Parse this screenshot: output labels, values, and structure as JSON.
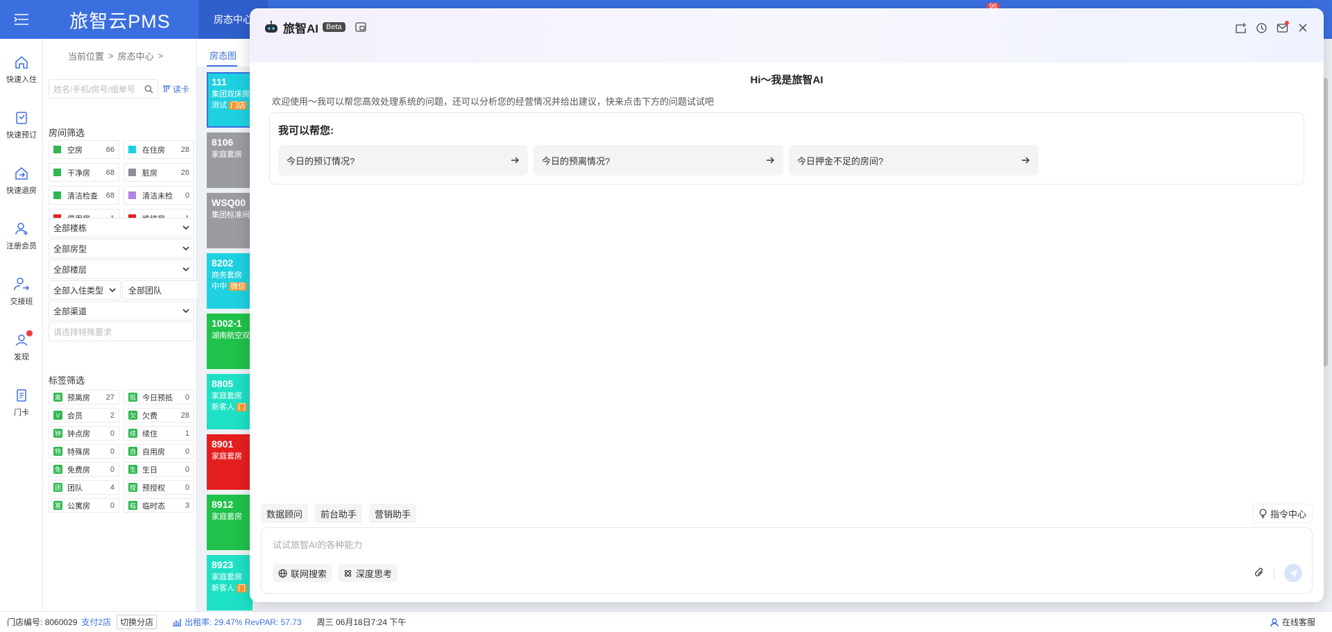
{
  "app": {
    "logo": "旅智云PMS",
    "top_tab": "房态中心",
    "top_badge": "96"
  },
  "rail": {
    "items": [
      {
        "label": "快速入住",
        "icon": "home-icon"
      },
      {
        "label": "快速预订",
        "icon": "booking-icon"
      },
      {
        "label": "快速退房",
        "icon": "checkout-icon"
      },
      {
        "label": "注册会员",
        "icon": "add-user-icon"
      },
      {
        "label": "交接班",
        "icon": "handover-icon"
      },
      {
        "label": "发现",
        "icon": "discover-icon"
      },
      {
        "label": "门卡",
        "icon": "card-icon"
      }
    ]
  },
  "filter": {
    "breadcrumb": [
      "当前位置",
      ">",
      "房态中心",
      ">"
    ],
    "search_placeholder": "姓名/手机/房号/组单号",
    "read_card": "读卡",
    "room_filter_title": "房间筛选",
    "room_status": [
      {
        "label": "空房",
        "count": "66",
        "color": "#2eb84f"
      },
      {
        "label": "在住房",
        "count": "28",
        "color": "#1ed1e0"
      },
      {
        "label": "干净房",
        "count": "68",
        "color": "#2eb84f"
      },
      {
        "label": "脏房",
        "count": "26",
        "color": "#8c8f96"
      },
      {
        "label": "清洁检查",
        "count": "68",
        "color": "#2eb84f"
      },
      {
        "label": "清洁未检",
        "count": "0",
        "color": "#b680e8"
      },
      {
        "label": "停用房",
        "count": "1",
        "color": "#e51f1f"
      },
      {
        "label": "维修房",
        "count": "1",
        "color": "#e51f1f"
      }
    ],
    "selects": {
      "building": "全部楼栋",
      "room_type": "全部房型",
      "floor": "全部楼层",
      "checkin_type": "全部入住类型",
      "team": "全部团队",
      "channel": "全部渠道"
    },
    "special_placeholder": "请选择特殊要求",
    "tag_filter_title": "标签筛选",
    "tags": [
      {
        "icon": "离",
        "label": "预离房",
        "count": "27"
      },
      {
        "icon": "抵",
        "label": "今日预抵",
        "count": "0"
      },
      {
        "icon": "V",
        "label": "会员",
        "count": "2"
      },
      {
        "icon": "欠",
        "label": "欠费",
        "count": "28"
      },
      {
        "icon": "钟",
        "label": "钟点房",
        "count": "0"
      },
      {
        "icon": "续",
        "label": "续住",
        "count": "1"
      },
      {
        "icon": "特",
        "label": "特殊房",
        "count": "0"
      },
      {
        "icon": "自",
        "label": "自用房",
        "count": "0"
      },
      {
        "icon": "免",
        "label": "免费房",
        "count": "0"
      },
      {
        "icon": "生",
        "label": "生日",
        "count": "0"
      },
      {
        "icon": "团",
        "label": "团队",
        "count": "4"
      },
      {
        "icon": "授",
        "label": "预授权",
        "count": "0"
      },
      {
        "icon": "富",
        "label": "公寓房",
        "count": "0"
      },
      {
        "icon": "临",
        "label": "临时态",
        "count": "3"
      }
    ]
  },
  "rooms": {
    "tab": "房态图",
    "cards": [
      {
        "num": "111",
        "type": "集团双床房",
        "extra": "测试",
        "tag": "门店",
        "color": "#1ed1e0"
      },
      {
        "num": "8106",
        "type": "家庭套房",
        "extra": "",
        "tag": "",
        "color": "#9a9ca1"
      },
      {
        "num": "WSQ00",
        "type": "集团标准间",
        "extra": "",
        "tag": "",
        "color": "#9a9ca1"
      },
      {
        "num": "8202",
        "type": "商务套房",
        "extra": "中中",
        "tag": "微信",
        "color": "#1ed1e0"
      },
      {
        "num": "1002-1",
        "type": "湖南航空双",
        "extra": "",
        "tag": "",
        "color": "#1fc24a"
      },
      {
        "num": "8805",
        "type": "家庭套房",
        "extra": "新客人",
        "tag": "门",
        "color": "#1ee0c5"
      },
      {
        "num": "8901",
        "type": "家庭套房",
        "extra": "",
        "tag": "",
        "color": "#e51f1f"
      },
      {
        "num": "8912",
        "type": "家庭套房",
        "extra": "",
        "tag": "",
        "color": "#1fc24a"
      },
      {
        "num": "8923",
        "type": "家庭套房",
        "extra": "新客人",
        "tag": "门",
        "color": "#1ee0c5"
      }
    ]
  },
  "statusbar": {
    "store_label": "门店编号:",
    "store_no": "8060029",
    "branch": "支付2店",
    "switch": "切换分店",
    "occupancy": "出租率: 29.47% RevPAR: 57.73",
    "datetime": "周三 06月18日7:24 下午",
    "service": "在线客服"
  },
  "ai": {
    "title": "旅智AI",
    "beta": "Beta",
    "greeting": "Hi～我是旅智AI",
    "welcome": "欢迎使用～我可以帮您高效处理系统的问题，还可以分析您的经营情况并给出建议，快来点击下方的问题试试吧",
    "help_title": "我可以帮您:",
    "questions": [
      "今日的预订情况?",
      "今日的预离情况?",
      "今日押金不足的房间?"
    ],
    "assistants": [
      "数据顾问",
      "前台助手",
      "营销助手"
    ],
    "command_center": "指令中心",
    "input_placeholder": "试试旅智AI的各种能力",
    "options": [
      "联网搜索",
      "深度思考"
    ],
    "accent": "#3b6fe0"
  }
}
